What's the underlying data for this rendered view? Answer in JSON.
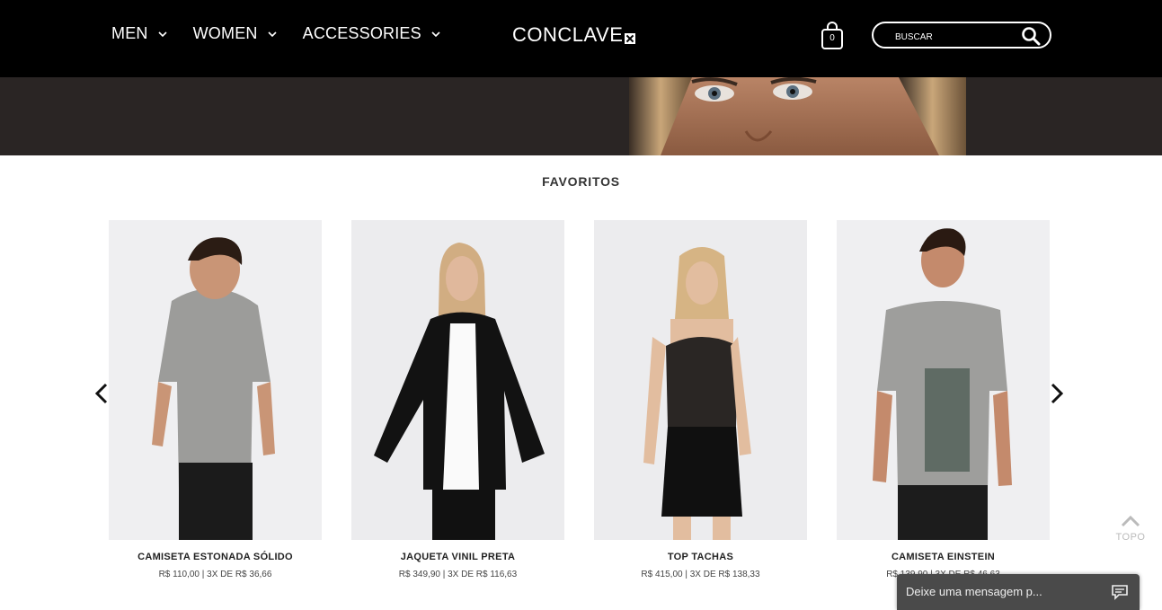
{
  "nav": {
    "items": [
      {
        "label": "MEN"
      },
      {
        "label": "WOMEN"
      },
      {
        "label": "ACCESSORIES"
      }
    ]
  },
  "logo": {
    "text": "CONCLAVE"
  },
  "cart": {
    "count": "0"
  },
  "search": {
    "placeholder": "BUSCAR"
  },
  "section": {
    "title": "FAVORITOS"
  },
  "products": [
    {
      "name": "CAMISETA ESTONADA SÓLIDO",
      "price": "R$ 110,00 | 3X DE R$ 36,66"
    },
    {
      "name": "JAQUETA VINIL PRETA",
      "price": "R$ 349,90 | 3X DE R$ 116,63"
    },
    {
      "name": "TOP TACHAS",
      "price": "R$ 415,00 | 3X DE R$ 138,33"
    },
    {
      "name": "CAMISETA EINSTEIN",
      "price": "R$ 139,90 | 3X DE R$ 46,63"
    }
  ],
  "topo": {
    "label": "TOPO"
  },
  "chat": {
    "placeholder": "Deixe uma mensagem p..."
  },
  "colors": {
    "header_bg": "#000000",
    "banner_bg": "#2a2524",
    "product_bg": "#ececee",
    "chat_bg": "#4a4a4a"
  },
  "icons": [
    "chevron-down-icon",
    "shopping-bag-icon",
    "search-icon",
    "chevron-left-icon",
    "chevron-right-icon",
    "chevron-up-icon",
    "chat-icon"
  ]
}
